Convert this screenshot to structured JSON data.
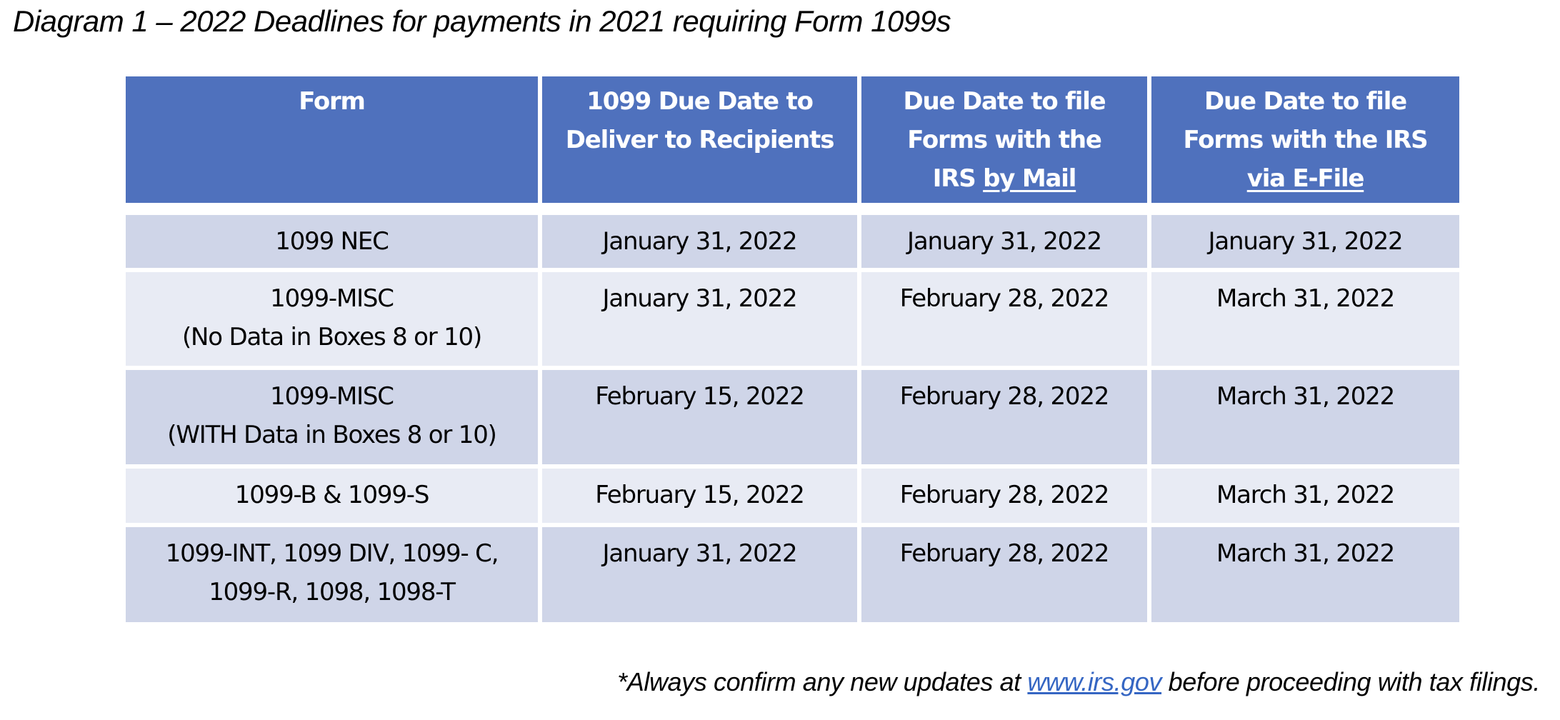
{
  "title": "Diagram 1 – 2022 Deadlines for payments in 2021 requiring Form 1099s",
  "table": {
    "headers": [
      {
        "lines": [
          "Form"
        ],
        "underlined": ""
      },
      {
        "lines": [
          "1099 Due Date to",
          "Deliver to Recipients"
        ],
        "underlined": ""
      },
      {
        "lines": [
          "Due Date to file",
          "Forms with the"
        ],
        "prefix": "IRS ",
        "underlined": "by Mail"
      },
      {
        "lines": [
          "Due Date to file",
          "Forms with the IRS"
        ],
        "prefix": "",
        "underlined": "via E-File"
      }
    ],
    "rows": [
      {
        "form": [
          "1099 NEC"
        ],
        "recipients": "January 31, 2022",
        "mail": "January 31, 2022",
        "efile": "January 31, 2022"
      },
      {
        "form": [
          "1099-MISC",
          "(No Data in Boxes 8 or 10)"
        ],
        "recipients": "January 31, 2022",
        "mail": "February 28, 2022",
        "efile": "March 31, 2022"
      },
      {
        "form": [
          "1099-MISC",
          "(WITH Data in Boxes 8 or 10)"
        ],
        "recipients": "February 15, 2022",
        "mail": "February 28, 2022",
        "efile": "March 31, 2022"
      },
      {
        "form": [
          "1099-B & 1099-S"
        ],
        "recipients": "February 15, 2022",
        "mail": "February 28, 2022",
        "efile": "March 31, 2022"
      },
      {
        "form": [
          "1099-INT, 1099 DIV, 1099- C,",
          "1099-R, 1098, 1098-T"
        ],
        "recipients": "January 31, 2022",
        "mail": "February 28, 2022",
        "efile": "March 31, 2022"
      }
    ]
  },
  "footnote": {
    "before": "*Always confirm any new updates at ",
    "link": "www.irs.gov",
    "after": " before proceeding with tax filings."
  },
  "colors": {
    "header_bg": "#4f71bd",
    "row_dark": "#cfd5e8",
    "row_light": "#e8ebf4",
    "link": "#3566c3"
  }
}
